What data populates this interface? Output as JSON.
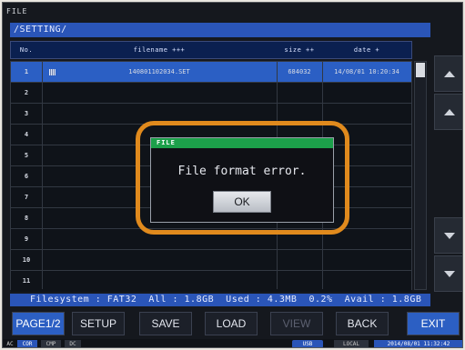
{
  "window": {
    "title": "FILE"
  },
  "path": "/SETTING/",
  "table": {
    "headers": {
      "no": "No.",
      "filename": "filename +++",
      "size": "size ++",
      "date": "date +"
    },
    "rows": [
      {
        "no": "1",
        "filename": "140801102034.SET",
        "size": "684032",
        "date": "14/08/01 10:20:34",
        "selected": true
      },
      {
        "no": "2",
        "filename": "",
        "size": "",
        "date": ""
      },
      {
        "no": "3",
        "filename": "",
        "size": "",
        "date": ""
      },
      {
        "no": "4",
        "filename": "",
        "size": "",
        "date": ""
      },
      {
        "no": "5",
        "filename": "",
        "size": "",
        "date": ""
      },
      {
        "no": "6",
        "filename": "",
        "size": "",
        "date": ""
      },
      {
        "no": "7",
        "filename": "",
        "size": "",
        "date": ""
      },
      {
        "no": "8",
        "filename": "",
        "size": "",
        "date": ""
      },
      {
        "no": "9",
        "filename": "",
        "size": "",
        "date": ""
      },
      {
        "no": "10",
        "filename": "",
        "size": "",
        "date": ""
      },
      {
        "no": "11",
        "filename": "",
        "size": "",
        "date": ""
      }
    ]
  },
  "filesystem_line": "Filesystem : FAT32  All : 1.8GB  Used : 4.3MB  0.2%  Avail : 1.8GB",
  "function_keys": [
    {
      "label": "PAGE1/2",
      "state": "active"
    },
    {
      "label": "SETUP",
      "state": "normal"
    },
    {
      "label": "SAVE",
      "state": "normal"
    },
    {
      "label": "LOAD",
      "state": "normal"
    },
    {
      "label": "VIEW",
      "state": "disabled"
    },
    {
      "label": "BACK",
      "state": "normal"
    },
    {
      "label": "EXIT",
      "state": "exit"
    }
  ],
  "status": {
    "ac": "AC",
    "cor": "COR",
    "cmp": "CMP",
    "dc": "DC",
    "usb": "USB",
    "local": "LOCAL",
    "datetime": "2014/08/01 11:32:42"
  },
  "dialog": {
    "title": "FILE",
    "message": "File format error.",
    "ok_label": "OK"
  },
  "colors": {
    "accent_blue": "#2a55b8",
    "highlight_frame": "#e08a1d",
    "dialog_title_green": "#1ca04a"
  }
}
